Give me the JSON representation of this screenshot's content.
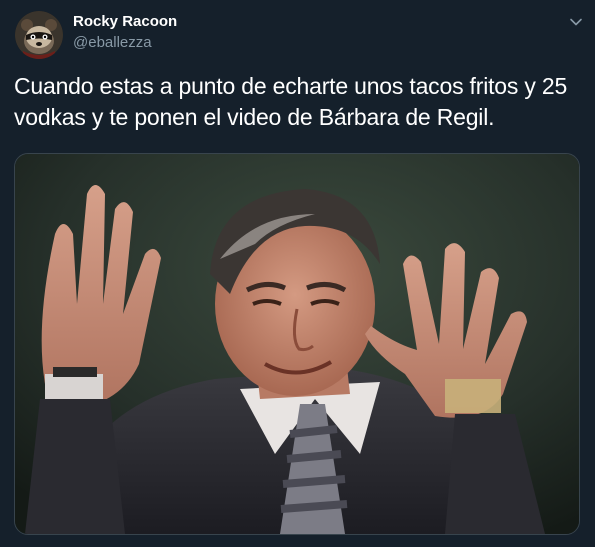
{
  "author": {
    "display_name": "Rocky Racoon",
    "handle": "@eballezza",
    "avatar_icon": "raccoon-avatar-icon"
  },
  "tweet": {
    "text": "Cuando estas a punto de echarte unos tacos fritos y 25 vodkas y te ponen el video de Bárbara de Regil."
  },
  "menu": {
    "icon": "chevron-down-icon"
  },
  "colors": {
    "background": "#15202b",
    "primary_text": "#ffffff",
    "secondary_text": "#8899a6",
    "border": "#38444d"
  }
}
